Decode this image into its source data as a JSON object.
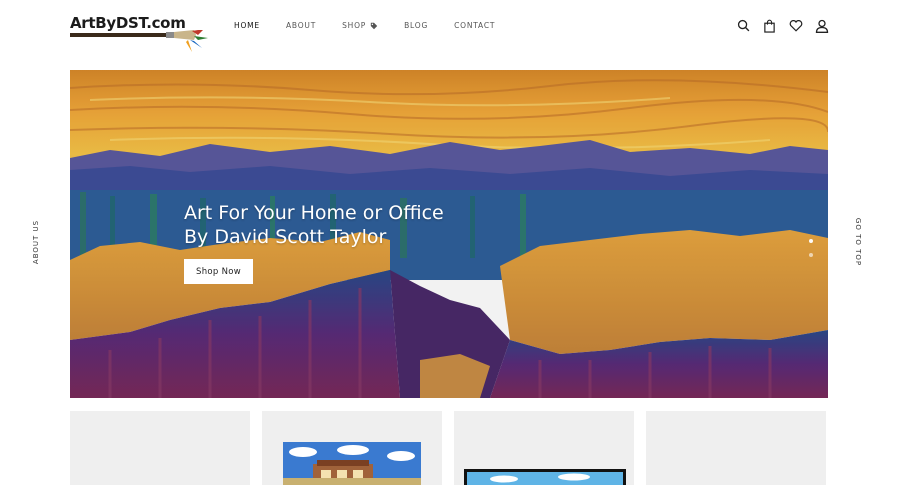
{
  "header": {
    "logo_text": "ArtByDST.com",
    "nav": [
      {
        "label": "HOME",
        "active": true
      },
      {
        "label": "ABOUT",
        "active": false
      },
      {
        "label": "SHOP",
        "active": false,
        "icon": "tag-icon"
      },
      {
        "label": "BLOG",
        "active": false
      },
      {
        "label": "CONTACT",
        "active": false
      }
    ],
    "icons": [
      "search-icon",
      "shopping-bag-icon",
      "heart-icon",
      "user-icon"
    ]
  },
  "side": {
    "left_label": "ABOUT US",
    "right_label": "GO TO TOP"
  },
  "hero": {
    "title_line1": "Art For Your Home or Office",
    "title_line2": "By David Scott Taylor",
    "button_label": "Shop Now",
    "slides": 2,
    "active_slide": 1
  },
  "colors": {
    "background": "#ffffff",
    "card_bg": "#efefef",
    "nav_text": "#555555",
    "button_bg": "#ffffff"
  }
}
